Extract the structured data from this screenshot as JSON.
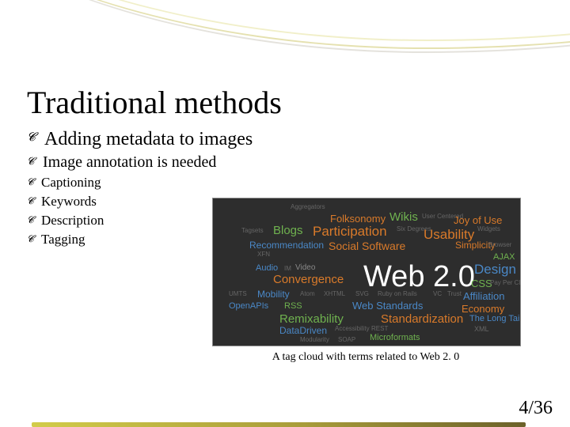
{
  "title": "Traditional methods",
  "bullets": {
    "l1": "Adding metadata to images",
    "l2": "Image annotation is needed",
    "l3a": "Captioning",
    "l3b": "Keywords",
    "l3c": "Description",
    "l3d": "Tagging"
  },
  "image_caption": "A tag cloud with terms related to Web 2. 0",
  "page_number": "4/36",
  "tagcloud": {
    "web20": "Web 2.0",
    "folksonomy": "Folksonomy",
    "wikis": "Wikis",
    "joy": "Joy of Use",
    "blogs": "Blogs",
    "participation": "Participation",
    "usability": "Usability",
    "recommendation": "Recommendation",
    "social_software": "Social Software",
    "simplicity": "Simplicity",
    "ajax": "AJAX",
    "design": "Design",
    "css": "CSS",
    "audio": "Audio",
    "video": "Video",
    "convergence": "Convergence",
    "mobility": "Mobility",
    "affiliation": "Affiliation",
    "openapis": "OpenAPIs",
    "rss": "RSS",
    "web_standards": "Web Standards",
    "economy": "Economy",
    "remixability": "Remixability",
    "standardization": "Standardization",
    "long_tail": "The Long Tail",
    "data_driven": "DataDriven",
    "microformats": "Microformats",
    "aggregators": "Aggregators",
    "six_degrees": "Six Degrees",
    "widgets": "Widgets",
    "browser": "Browser",
    "pay_per_click": "Pay Per Click",
    "xml": "XML",
    "soap": "SOAP",
    "modularity": "Modularity",
    "accessibility": "Accessibility",
    "rest": "REST",
    "im": "IM",
    "xfn": "XFN",
    "tagsets": "Tagsets",
    "user_centered": "User Centered",
    "atom": "Atom",
    "xhtml": "XHTML",
    "svg": "SVG",
    "ruby": "Ruby on Rails",
    "vc": "VC",
    "trust": "Trust",
    "umts": "UMTS"
  }
}
